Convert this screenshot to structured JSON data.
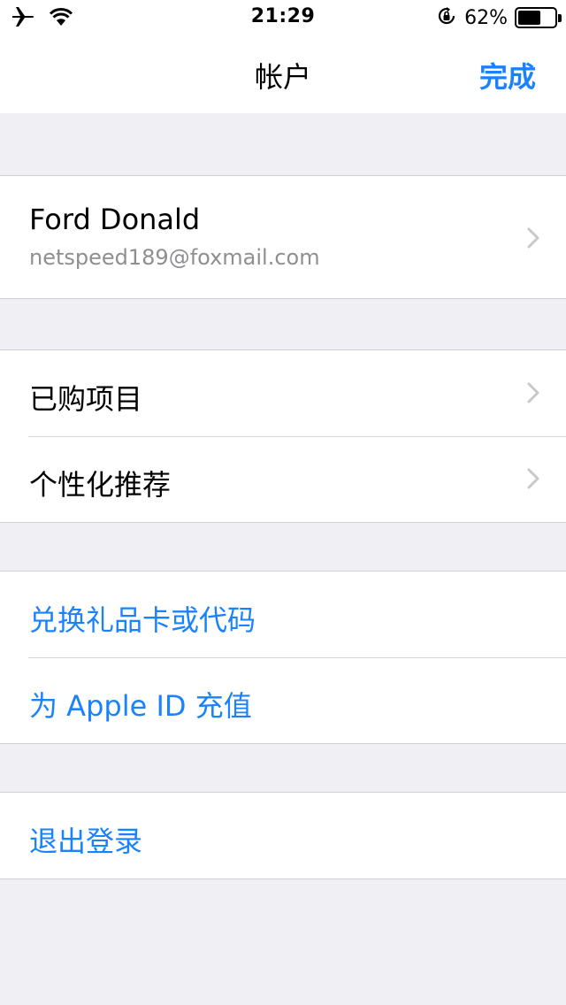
{
  "status_bar": {
    "time": "21:29",
    "battery_percent": "62%",
    "battery_level": 0.62,
    "icons": [
      "airplane-icon",
      "wifi-icon",
      "orientation-lock-icon",
      "battery-icon"
    ]
  },
  "nav": {
    "title": "帐户",
    "done_label": "完成"
  },
  "profile": {
    "name": "Ford Donald",
    "email": "netspeed189@foxmail.com"
  },
  "group_purchases": {
    "items": [
      {
        "label": "已购项目"
      },
      {
        "label": "个性化推荐"
      }
    ]
  },
  "group_gift": {
    "items": [
      {
        "label": "兑换礼品卡或代码"
      },
      {
        "label": "为 Apple ID 充值"
      }
    ]
  },
  "signout": {
    "label": "退出登录"
  },
  "colors": {
    "accent": "#1a82fb",
    "background": "#efeff4",
    "secondary_text": "#8e8e93"
  }
}
